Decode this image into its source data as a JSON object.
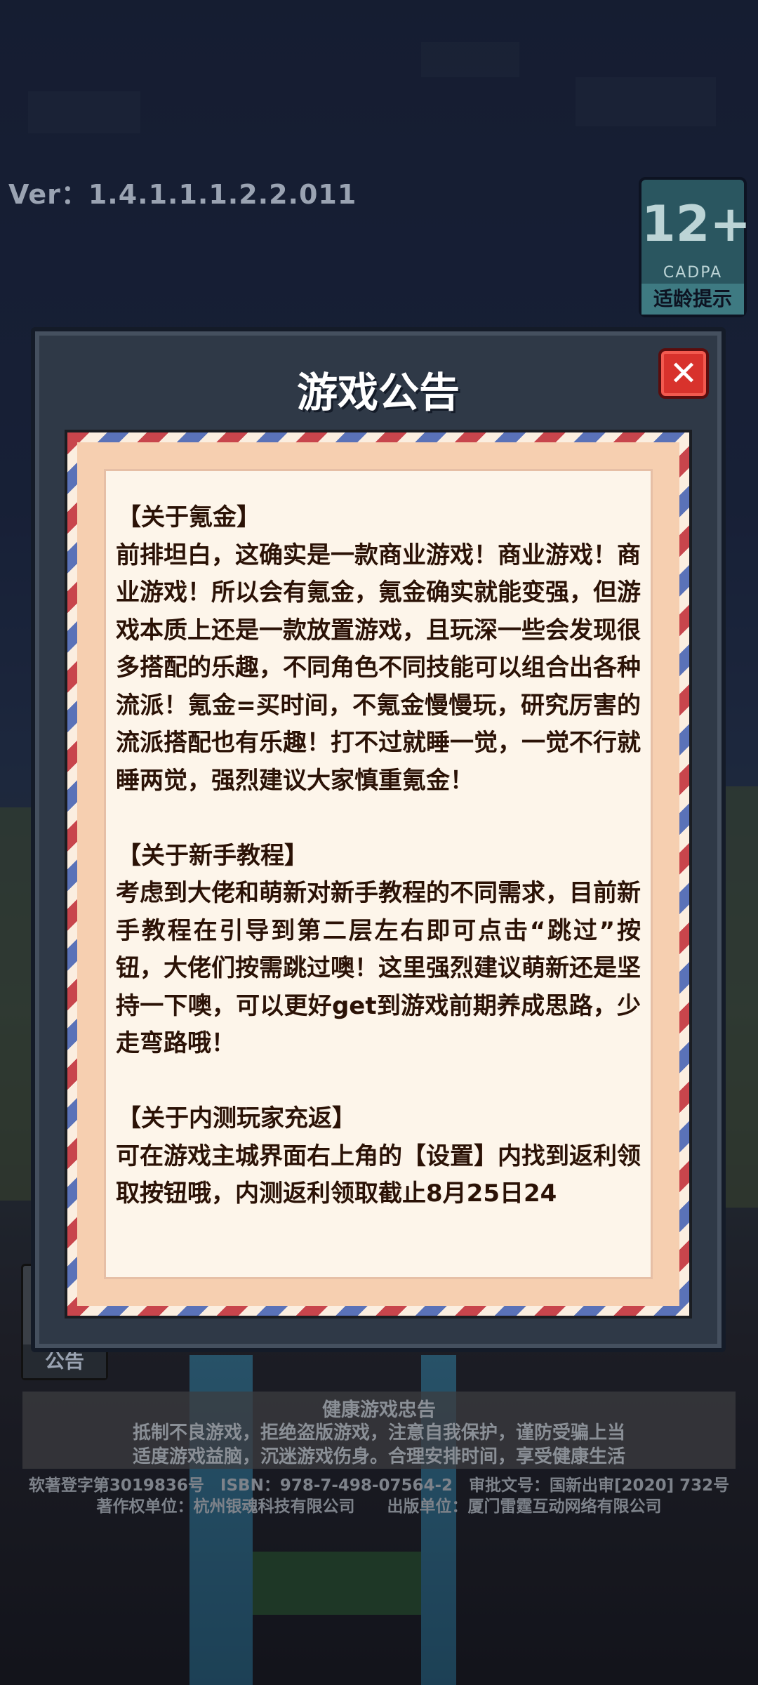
{
  "version_text": "Ver：1.4.1.1.1.2.2.011",
  "age_rating": {
    "number": "12+",
    "org": "CADPA",
    "hint": "适龄提示"
  },
  "side_button": {
    "label": "公告"
  },
  "dialog": {
    "title": "游戏公告",
    "close_icon": "close-icon",
    "sections": [
      {
        "heading": "【关于氪金】",
        "body": "前排坦白，这确实是一款商业游戏！商业游戏！商业游戏！所以会有氪金，氪金确实就能变强，但游戏本质上还是一款放置游戏，且玩深一些会发现很多搭配的乐趣，不同角色不同技能可以组合出各种流派！氪金=买时间，不氪金慢慢玩，研究厉害的流派搭配也有乐趣！打不过就睡一觉，一觉不行就睡两觉，强烈建议大家慎重氪金！"
      },
      {
        "heading": "【关于新手教程】",
        "body": "考虑到大佬和萌新对新手教程的不同需求，目前新手教程在引导到第二层左右即可点击“跳过”按钮，大佬们按需跳过噢！这里强烈建议萌新还是坚持一下噢，可以更好get到游戏前期养成思路，少走弯路哦！"
      },
      {
        "heading": "【关于内测玩家充返】",
        "body": "可在游戏主城界面右上角的【设置】内找到返利领取按钮哦，内测返利领取截止8月25日24"
      }
    ]
  },
  "health_notice": {
    "title": "健康游戏忠告",
    "line1": "抵制不良游戏，拒绝盗版游戏，注意自我保护，谨防受骗上当",
    "line2": "适度游戏益脑，沉迷游戏伤身。合理安排时间，享受健康生活"
  },
  "footer": {
    "line1": "软著登字第3019836号　ISBN：978-7-498-07564-2　审批文号：国新出审[2020] 732号",
    "line2": "著作权单位：杭州银魂科技有限公司　　出版单位：厦门雷霆互动网络有限公司"
  },
  "colors": {
    "dialog_bg": "#2f3947",
    "paper_bg": "#fdf5ea",
    "stripe_red": "#c8454c",
    "stripe_blue": "#5a72b8",
    "close_red": "#d8322c"
  }
}
